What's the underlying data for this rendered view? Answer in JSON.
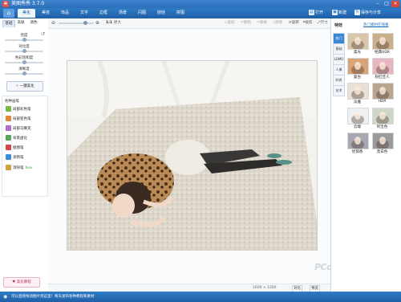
{
  "window": {
    "app_icon": "美",
    "title": "美图秀秀 3.7.0",
    "controls": [
      "–",
      "□",
      "×"
    ]
  },
  "tabs": {
    "home_icon": "⌂",
    "items": [
      {
        "label": "美化",
        "active": true
      },
      {
        "label": "美容"
      },
      {
        "label": "饰品"
      },
      {
        "label": "文字"
      },
      {
        "label": "边框"
      },
      {
        "label": "场景"
      },
      {
        "label": "闪图"
      },
      {
        "label": "娃娃"
      },
      {
        "label": "拼图"
      }
    ],
    "right_tools": [
      {
        "icon": "▤",
        "label": "打开"
      },
      {
        "icon": "▣",
        "label": "新建"
      },
      {
        "icon": "✎",
        "label": "保存与分享"
      }
    ]
  },
  "left_panel": {
    "subtabs": [
      {
        "label": "基础",
        "active": true
      },
      {
        "label": "高级"
      },
      {
        "label": "调色"
      }
    ],
    "reset_icon": "↺",
    "sliders": [
      {
        "label": "亮度",
        "value": 0.5
      },
      {
        "label": "对比度",
        "value": 0.5
      },
      {
        "label": "色彩饱和度",
        "value": 0.5
      },
      {
        "label": "清晰度",
        "value": 0.5
      }
    ],
    "one_key_button": "一键美化",
    "effects_title": "各种画笔",
    "effects": [
      {
        "label": "局部彩色笔",
        "color": "#7bb84a"
      },
      {
        "label": "局部变色笔",
        "color": "#e0883a"
      },
      {
        "label": "局部马赛克",
        "color": "#b06cc8"
      },
      {
        "label": "背景虚化",
        "color": "#58a55c"
      },
      {
        "label": "抠图笔",
        "color": "#d14b4b"
      },
      {
        "label": "涂鸦笔",
        "color": "#3b8ed8"
      },
      {
        "label": "消除笔",
        "color": "#d1a13b",
        "badge": "New"
      }
    ],
    "beauty_button": "美化教程"
  },
  "center_toolbar": {
    "zoom_label": "1:1",
    "zoom_text": "原大",
    "zoom_value": 0.75,
    "actions": [
      "基础",
      "撤销",
      "重做",
      "原图"
    ],
    "right_actions": [
      "旋转",
      "裁剪",
      "尺寸"
    ]
  },
  "canvas": {
    "image_description": "photo"
  },
  "status": {
    "dims": "1600 × 1200",
    "buttons": [
      "对比",
      "预览"
    ]
  },
  "right_panel": {
    "header": "特效",
    "link": "热门素材在线看",
    "vtabs": [
      {
        "label": "热门",
        "active": true
      },
      {
        "label": "基础"
      },
      {
        "label": "LOMO"
      },
      {
        "label": "人像"
      },
      {
        "label": "时尚"
      },
      {
        "label": "艺术"
      }
    ],
    "thumbs": [
      {
        "label": "柔光",
        "tint": "#d9c6a8"
      },
      {
        "label": "经典HDR",
        "tint": "#c9b08c"
      },
      {
        "label": "复古",
        "tint": "#d8a57a"
      },
      {
        "label": "粉红佳人",
        "tint": "#e7b7c1"
      },
      {
        "label": "淡雅",
        "tint": "#e9e1d4"
      },
      {
        "label": "HDR",
        "tint": "#b8a68f"
      },
      {
        "label": "云端",
        "tint": "#eef0f2"
      },
      {
        "label": "阿宝色",
        "tint": "#cfd8c8"
      },
      {
        "label": "忧郁香",
        "tint": "#a7a8b2"
      },
      {
        "label": "黑白色",
        "tint": "#9b9b9b"
      }
    ]
  },
  "bottom_bar": {
    "text": "可以直接拖动图片到这里！每天发布各种教程和素材",
    "icon": "◉"
  },
  "watermark": "PConline"
}
